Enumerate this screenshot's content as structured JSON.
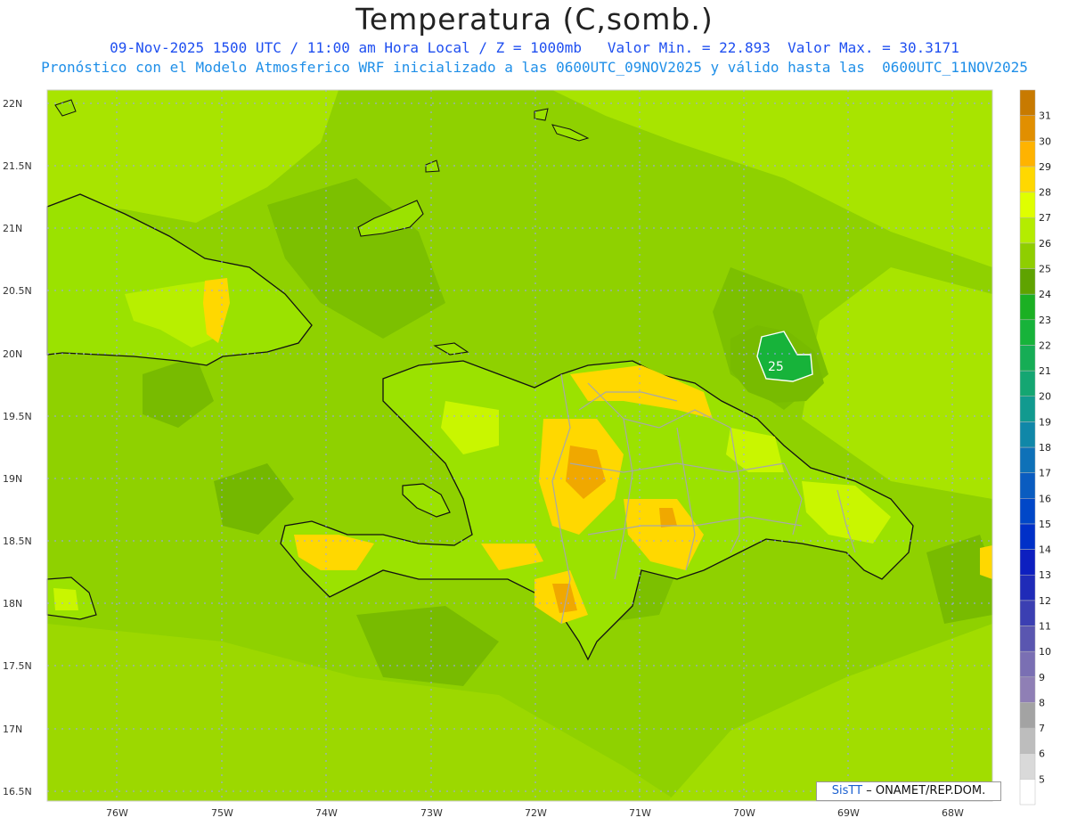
{
  "header": {
    "title": "Temperatura (C,somb.)",
    "line1": "09-Nov-2025 1500 UTC / 11:00 am Hora Local / Z = 1000mb   Valor Min. = 22.893  Valor Max. = 30.3171",
    "line2": "Pronóstico con el Modelo Atmosferico WRF inicializado a las 0600UTC_09NOV2025 y válido hasta las  0600UTC_11NOV2025"
  },
  "axes": {
    "lat_labels": [
      "22N",
      "21.5N",
      "21N",
      "20.5N",
      "20N",
      "19.5N",
      "19N",
      "18.5N",
      "18N",
      "17.5N",
      "17N",
      "16.5N"
    ],
    "lon_labels": [
      "76W",
      "75W",
      "74W",
      "73W",
      "72W",
      "71W",
      "70W",
      "69W",
      "68W"
    ]
  },
  "contour_label": "25",
  "colorbar": {
    "labels": [
      "5",
      "6",
      "7",
      "8",
      "9",
      "10",
      "11",
      "12",
      "13",
      "14",
      "15",
      "16",
      "17",
      "18",
      "19",
      "20",
      "21",
      "22",
      "23",
      "24",
      "25",
      "26",
      "27",
      "28",
      "29",
      "30",
      "31"
    ],
    "colors": [
      "#ffffff",
      "#d9d9d9",
      "#bdbdbd",
      "#a3a3a3",
      "#8f7fb5",
      "#7a6fb3",
      "#5a56b0",
      "#3b3fb2",
      "#1f2bb8",
      "#0d1fc0",
      "#0030c8",
      "#0047c8",
      "#0a5cc0",
      "#0e71b8",
      "#1087a8",
      "#119a8f",
      "#14a672",
      "#16ad55",
      "#17b33a",
      "#1bb023",
      "#5fa300",
      "#8fce00",
      "#b4ec00",
      "#dfff00",
      "#ffd800",
      "#ffb300",
      "#e18f00",
      "#c87a00"
    ],
    "colors_note": "map-fill-colors"
  },
  "map_colors": {
    "sea": "#8fd100",
    "warm_sea": "#a8e400",
    "cool_sea": "#6fb000",
    "land": "#9be200",
    "hot": "#ffd800",
    "hotter": "#f0a800",
    "green": "#17b33a",
    "coast": "#111111",
    "province": "#a8a8a8",
    "grid": "#9aa0ff"
  },
  "credit": {
    "brand": "SisTT",
    "text": "– ONAMET/REP.DOM."
  }
}
